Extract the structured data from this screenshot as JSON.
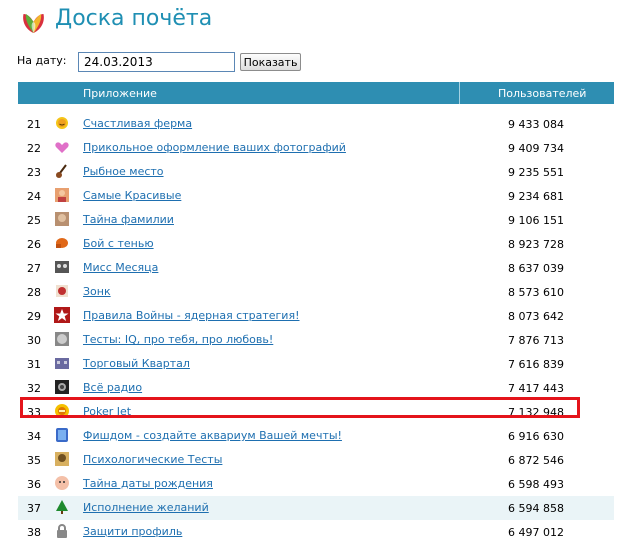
{
  "header": {
    "title": "Доска почёта"
  },
  "date_filter": {
    "label": "На дату:",
    "value": "24.03.2013",
    "button_label": "Показать"
  },
  "table": {
    "col_app": "Приложение",
    "col_users": "Пользователей",
    "rows": [
      {
        "rank": "21",
        "icon": "sun-smile-icon",
        "name": "Счастливая ферма",
        "users": "9 433 084"
      },
      {
        "rank": "22",
        "icon": "heart-icon",
        "name": "Прикольное оформление ваших фотографий",
        "users": "9 409 734"
      },
      {
        "rank": "23",
        "icon": "fishing-rod-icon",
        "name": "Рыбное место",
        "users": "9 235 551"
      },
      {
        "rank": "24",
        "icon": "person-photo-icon",
        "name": "Самые Красивые",
        "users": "9 234 681"
      },
      {
        "rank": "25",
        "icon": "face-photo-icon",
        "name": "Тайна фамилии",
        "users": "9 106 151"
      },
      {
        "rank": "26",
        "icon": "boxing-glove-icon",
        "name": "Бой с тенью",
        "users": "8 923 728"
      },
      {
        "rank": "27",
        "icon": "mask-icon",
        "name": "Мисс Месяца",
        "users": "8 637 039"
      },
      {
        "rank": "28",
        "icon": "cube-icon",
        "name": "Зонк",
        "users": "8 573 610"
      },
      {
        "rank": "29",
        "icon": "red-star-icon",
        "name": "Правила Войны - ядерная стратегия!",
        "users": "8 073 642"
      },
      {
        "rank": "30",
        "icon": "gray-face-icon",
        "name": "Тесты: IQ, про тебя, про любовь!",
        "users": "7 876 713"
      },
      {
        "rank": "31",
        "icon": "shop-building-icon",
        "name": "Торговый Квартал",
        "users": "7 616 839"
      },
      {
        "rank": "32",
        "icon": "radio-icon",
        "name": "Всё радио",
        "users": "7 417 443"
      },
      {
        "rank": "33",
        "icon": "poker-chip-icon",
        "name": "Poker Jet",
        "users": "7 132 948"
      },
      {
        "rank": "34",
        "icon": "aquarium-icon",
        "name": "Фишдом - создайте аквариум Вашей мечты!",
        "users": "6 916 630"
      },
      {
        "rank": "35",
        "icon": "psych-test-icon",
        "name": "Психологические Тесты",
        "users": "6 872 546"
      },
      {
        "rank": "36",
        "icon": "baby-face-icon",
        "name": "Тайна даты рождения",
        "users": "6 598 493"
      },
      {
        "rank": "37",
        "icon": "christmas-tree-icon",
        "name": "Исполнение желаний",
        "users": "6 594 858"
      },
      {
        "rank": "38",
        "icon": "lock-icon",
        "name": "Защити профиль",
        "users": "6 497 012"
      }
    ]
  },
  "colors": {
    "accent": "#2e8eb2",
    "title": "#1f8fb3",
    "link": "#1e6fb0",
    "highlight": "#e4141b",
    "alt_row": "#eaf4f7"
  }
}
